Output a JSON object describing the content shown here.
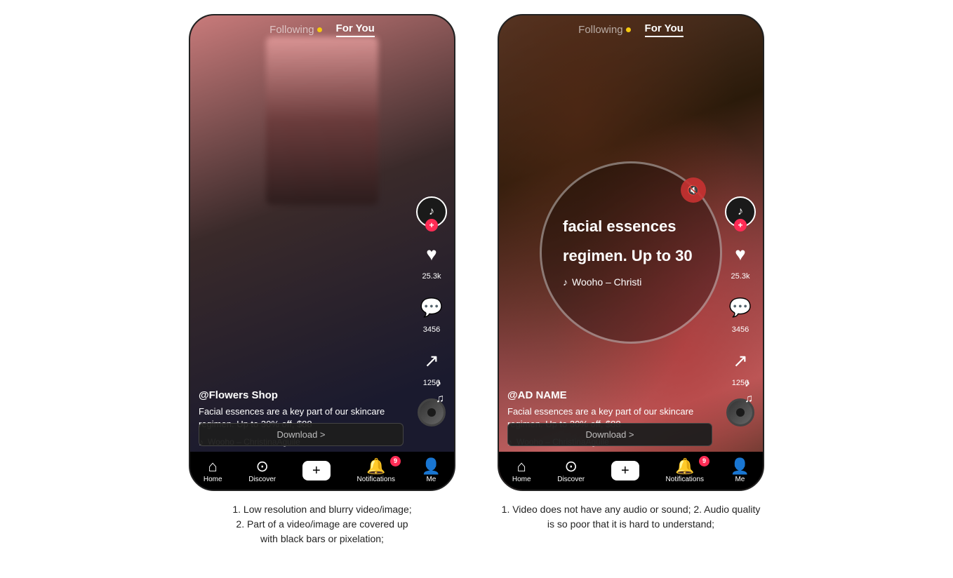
{
  "left_phone": {
    "header": {
      "following_label": "Following",
      "for_you_label": "For You"
    },
    "video": {
      "bg_type": "portrait"
    },
    "sidebar": {
      "likes": "25.3k",
      "comments": "3456",
      "shares": "1256"
    },
    "info": {
      "username": "@Flowers Shop",
      "description": "Facial essences are a key part of our skincare regimen. Up to 30% off, $88",
      "song": "Wooho – ChristinaAguile"
    },
    "download": {
      "label": "Download >"
    },
    "nav": {
      "home": "Home",
      "discover": "Discover",
      "notifications": "Notifications",
      "me": "Me",
      "notif_count": "9"
    }
  },
  "right_phone": {
    "header": {
      "following_label": "Following",
      "for_you_label": "For You"
    },
    "video": {
      "bg_type": "forest"
    },
    "mute": {
      "text_line1": "facial essences",
      "text_line2": "regimen. Up to 30",
      "song": "Wooho – Christi"
    },
    "sidebar": {
      "likes": "25.3k",
      "comments": "3456",
      "shares": "1256"
    },
    "info": {
      "username": "@AD NAME",
      "description": "Facial essences are a key part of our skincare regimen. Up to 30% off, $88",
      "song": "Wooho – ChristinaAguile"
    },
    "download": {
      "label": "Download >"
    },
    "nav": {
      "home": "Home",
      "discover": "Discover",
      "notifications": "Notifications",
      "me": "Me",
      "notif_count": "9"
    }
  },
  "captions": {
    "left": "1. Low resolution and blurry video/image;\n2. Part of a video/image are covered up\nwith black bars or pixelation;",
    "right": "1. Video does not have any audio or sound; 2. Audio quality is so poor that it is hard to understand;"
  }
}
